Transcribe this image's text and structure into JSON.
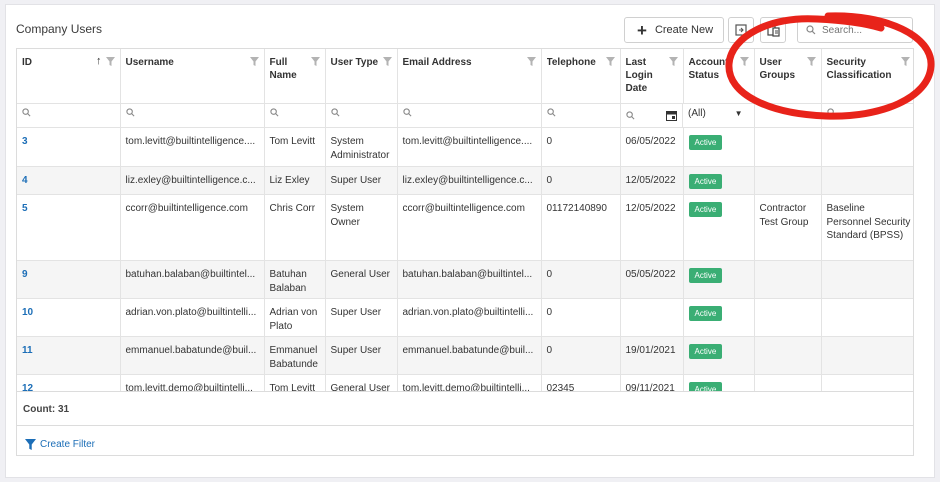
{
  "header": {
    "title": "Company Users",
    "create_label": "Create New",
    "search_placeholder": "Search..."
  },
  "columns": [
    {
      "key": "id",
      "label": "ID"
    },
    {
      "key": "username",
      "label": "Username"
    },
    {
      "key": "fullname",
      "label": "Full Name"
    },
    {
      "key": "usertype",
      "label": "User Type"
    },
    {
      "key": "email",
      "label": "Email Address"
    },
    {
      "key": "telephone",
      "label": "Telephone"
    },
    {
      "key": "lastlogin",
      "label": "Last Login Date"
    },
    {
      "key": "status",
      "label": "Account Status"
    },
    {
      "key": "groups",
      "label": "User Groups"
    },
    {
      "key": "security",
      "label": "Security Classification"
    }
  ],
  "status_filter_value": "(All)",
  "rows": [
    {
      "id": "3",
      "username": "tom.levitt@builtintelligence....",
      "fullname": "Tom Levitt",
      "usertype": "System Administrator",
      "email": "tom.levitt@builtintelligence....",
      "telephone": "0",
      "lastlogin": "06/05/2022",
      "status": "Active",
      "groups": "",
      "security": ""
    },
    {
      "id": "4",
      "username": "liz.exley@builtintelligence.c...",
      "fullname": "Liz Exley",
      "usertype": "Super User",
      "email": "liz.exley@builtintelligence.c...",
      "telephone": "0",
      "lastlogin": "12/05/2022",
      "status": "Active",
      "groups": "",
      "security": ""
    },
    {
      "id": "5",
      "username": "ccorr@builtintelligence.com",
      "fullname": "Chris Corr",
      "usertype": "System Owner",
      "email": "ccorr@builtintelligence.com",
      "telephone": "01172140890",
      "lastlogin": "12/05/2022",
      "status": "Active",
      "groups": "Contractor Test Group",
      "security": "Baseline Personnel Security Standard (BPSS)"
    },
    {
      "id": "9",
      "username": "batuhan.balaban@builtintel...",
      "fullname": "Batuhan Balaban",
      "usertype": "General User",
      "email": "batuhan.balaban@builtintel...",
      "telephone": "0",
      "lastlogin": "05/05/2022",
      "status": "Active",
      "groups": "",
      "security": ""
    },
    {
      "id": "10",
      "username": "adrian.von.plato@builtintelli...",
      "fullname": "Adrian von Plato",
      "usertype": "Super User",
      "email": "adrian.von.plato@builtintelli...",
      "telephone": "0",
      "lastlogin": "",
      "status": "Active",
      "groups": "",
      "security": ""
    },
    {
      "id": "11",
      "username": "emmanuel.babatunde@buil...",
      "fullname": "Emmanuel Babatunde",
      "usertype": "Super User",
      "email": "emmanuel.babatunde@buil...",
      "telephone": "0",
      "lastlogin": "19/01/2021",
      "status": "Active",
      "groups": "",
      "security": ""
    },
    {
      "id": "12",
      "username": "tom.levitt.demo@builtintelli...",
      "fullname": "Tom Levitt",
      "usertype": "General User",
      "email": "tom.levitt.demo@builtintelli...",
      "telephone": "02345",
      "lastlogin": "09/11/2021",
      "status": "Active",
      "groups": "",
      "security": ""
    }
  ],
  "footer": {
    "count_label": "Count: 31",
    "create_filter_label": "Create Filter"
  },
  "colors": {
    "accent": "#1c6eb7",
    "active_badge": "#3aae74",
    "annotation": "#e8231a"
  },
  "icons": [
    "plus-icon",
    "export-icon",
    "column-chooser-icon",
    "search-icon",
    "filter-funnel-icon",
    "sort-asc-icon",
    "calendar-icon",
    "dropdown-caret-icon"
  ]
}
